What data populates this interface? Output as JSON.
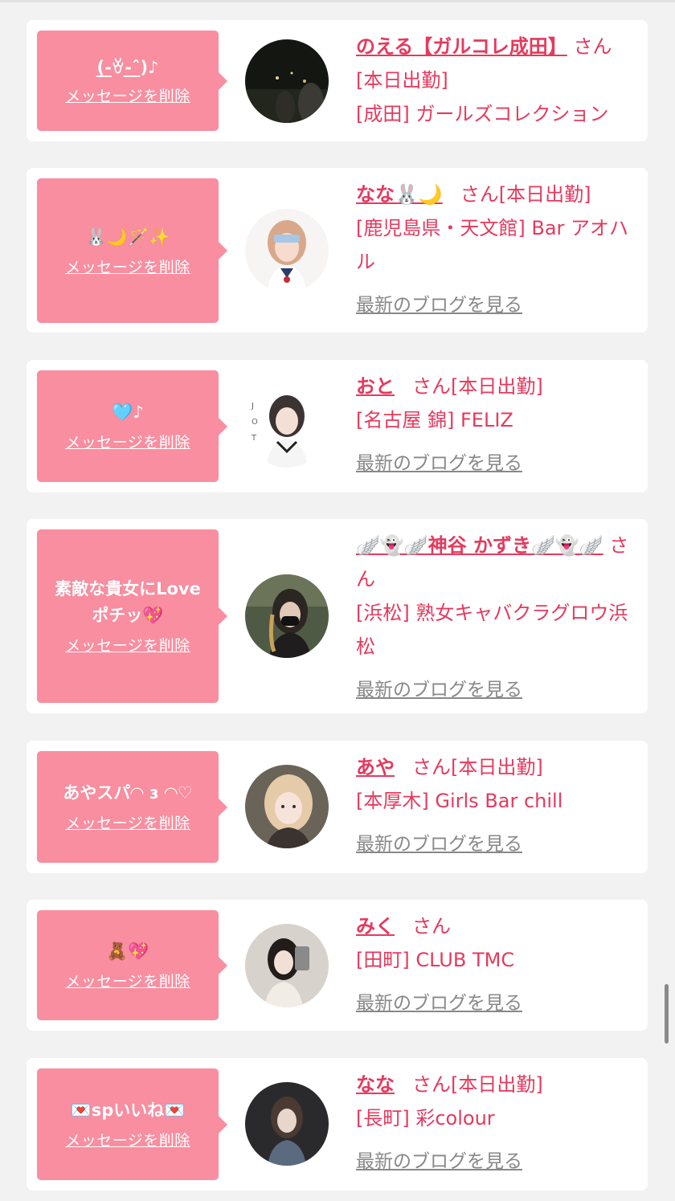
{
  "cards": [
    {
      "message": "(̲-̲ꈊ-̲ˆ̲)♪",
      "delete_label": "メッセージを削除",
      "name": "のえる【ガルコレ成田】",
      "san_label": "さん",
      "status": "[本日出勤]",
      "shop": "[成田] ガールズコレクション",
      "blog_label": ""
    },
    {
      "message": "🐰🌙🪄✨",
      "delete_label": "メッセージを削除",
      "name": "なな🐰🌙",
      "san_label": "さん",
      "status": "[本日出勤]",
      "shop": "[鹿児島県・天文館] Bar アオハル",
      "blog_label": "最新のブログを見る"
    },
    {
      "message": "🩵♪",
      "delete_label": "メッセージを削除",
      "name": "おと",
      "san_label": "さん",
      "status": "[本日出勤]",
      "shop": "[名古屋 錦] FELIZ",
      "blog_label": "最新のブログを見る"
    },
    {
      "message": "素敵な貴女にLove",
      "message2": "ポチッ💖",
      "delete_label": "メッセージを削除",
      "name": "🪽👻🪽神谷 かずき🪽👻🪽",
      "san_label": "さん",
      "status": "",
      "shop": "[浜松] 熟女キャバクラグロウ浜松",
      "blog_label": "最新のブログを見る"
    },
    {
      "message": "あやスパ◠ ɜ ◠♡",
      "delete_label": "メッセージを削除",
      "name": "あや",
      "san_label": "さん",
      "status": "[本日出勤]",
      "shop": "[本厚木] Girls Bar chill",
      "blog_label": "最新のブログを見る"
    },
    {
      "message": "🧸💖",
      "delete_label": "メッセージを削除",
      "name": "みく",
      "san_label": "さん",
      "status": "",
      "shop": "[田町] CLUB TMC",
      "blog_label": "最新のブログを見る"
    },
    {
      "message": "💌spいいね💌",
      "delete_label": "メッセージを削除",
      "name": "なな",
      "san_label": "さん",
      "status": "[本日出勤]",
      "shop": "[長町] 彩colour",
      "blog_label": "最新のブログを見る"
    }
  ],
  "colors": {
    "accent": "#e43a5e",
    "bubble": "#f98ea0",
    "background": "#f2f2f2",
    "link_gray": "#888888"
  }
}
